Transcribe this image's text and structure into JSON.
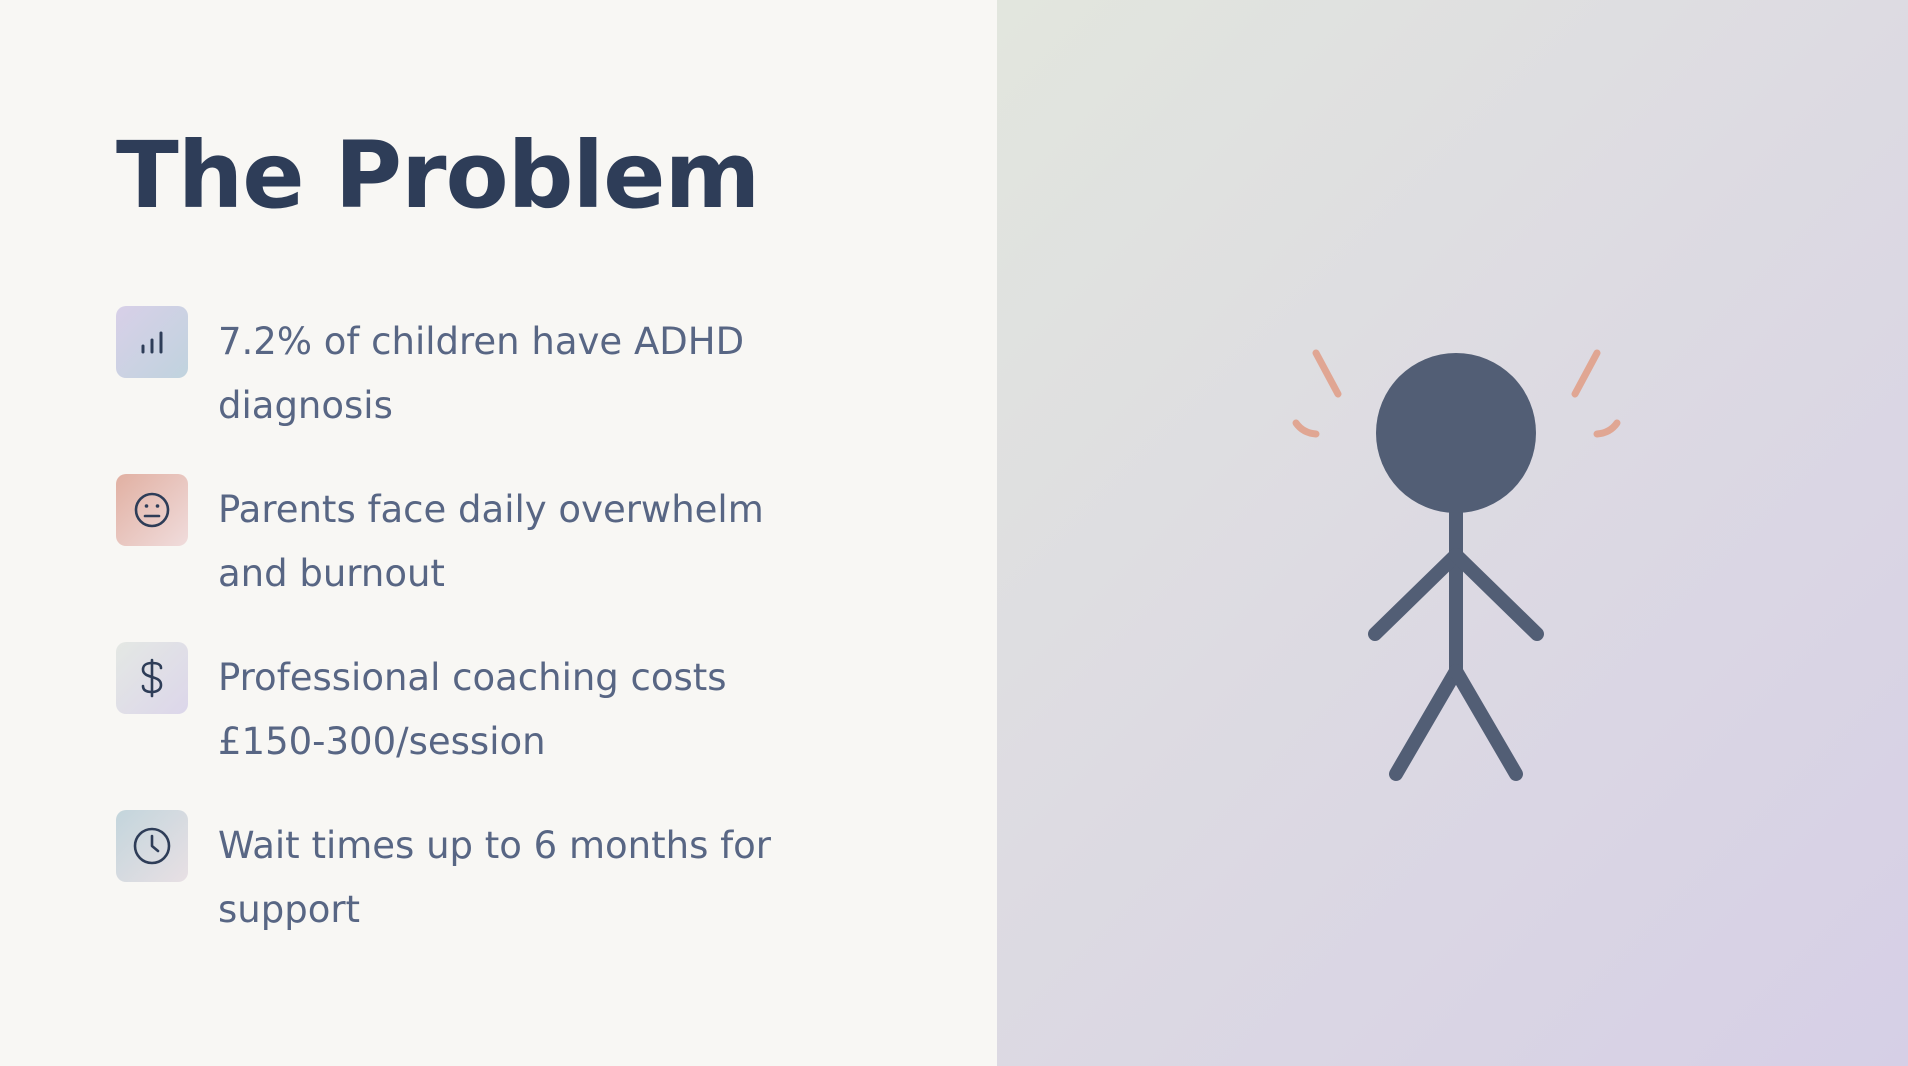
{
  "slide": {
    "title": "The Problem",
    "items": [
      {
        "icon": "bar-chart-icon",
        "text": "7.2% of children have ADHD diagnosis"
      },
      {
        "icon": "neutral-face-icon",
        "text": "Parents face daily overwhelm and burnout"
      },
      {
        "icon": "dollar-icon",
        "text": "Professional coaching costs £150-300/session"
      },
      {
        "icon": "clock-icon",
        "text": "Wait times up to 6 months for support"
      }
    ]
  },
  "illustration": {
    "subject": "stressed-stick-figure-icon",
    "colors": {
      "figure": "#525e75",
      "stress_marks": "#e0a693",
      "title": "#2e3d58",
      "text": "#586684",
      "left_bg": "#f8f7f4"
    }
  }
}
